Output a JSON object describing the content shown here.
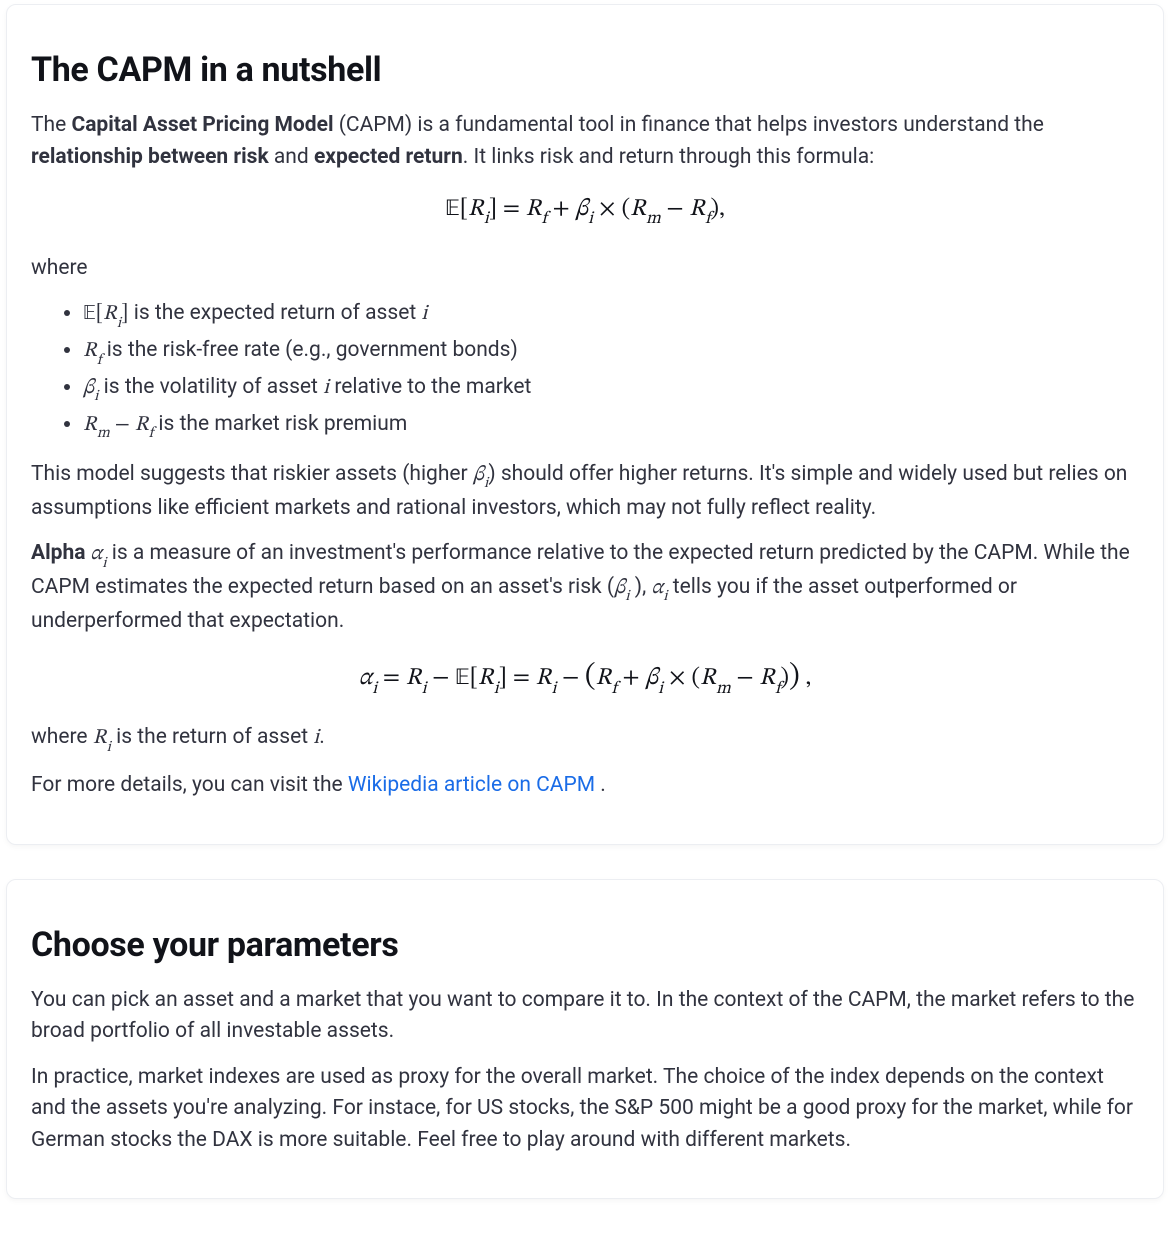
{
  "card1": {
    "heading": "The CAPM in a nutshell",
    "intro_pre": "The ",
    "intro_bold1": "Capital Asset Pricing Model",
    "intro_mid1": " (CAPM) is a fundamental tool in finance that helps investors understand the ",
    "intro_bold2": "relationship between risk",
    "intro_mid2": " and ",
    "intro_bold3": "expected return",
    "intro_post": ". It links risk and return through this formula:",
    "formula1": "𝔼[Rᵢ] = R_f + βᵢ × (Rₘ − R_f),",
    "where_label": "where",
    "defs": {
      "d1_sym": "𝔼[Rᵢ]",
      "d1_txt": " is the expected return of asset ",
      "d1_var": "i",
      "d2_sym": "R_f",
      "d2_txt": " is the risk-free rate (e.g., government bonds)",
      "d3_sym": "βᵢ",
      "d3_txt": " is the volatility of asset ",
      "d3_var": "i",
      "d3_txt2": " relative to the market",
      "d4_sym": "Rₘ − R_f",
      "d4_txt": " is the market risk premium"
    },
    "para2_a": "This model suggests that riskier assets (higher ",
    "para2_beta": "βᵢ",
    "para2_b": ") should offer higher returns. It's simple and widely used but relies on assumptions like efficient markets and rational investors, which may not fully reflect reality.",
    "para3_bold": "Alpha",
    "para3_alpha": " αᵢ",
    "para3_a": " is a measure of an investment's performance relative to the expected return predicted by the CAPM. While the CAPM estimates the expected return based on an asset's risk (",
    "para3_beta2": "βᵢ",
    "para3_b": " ), ",
    "para3_alpha2": "αᵢ",
    "para3_c": " tells you if the asset outperformed or underperformed that expectation.",
    "formula2": "αᵢ = Rᵢ − 𝔼[Rᵢ] = Rᵢ − (R_f + βᵢ × (Rₘ − R_f)) ,",
    "where2_a": "where ",
    "where2_sym": "Rᵢ",
    "where2_b": " is the return of asset ",
    "where2_var": "i",
    "where2_c": ".",
    "link_pre": "For more details, you can visit the ",
    "link_text": "Wikipedia article on CAPM",
    "link_post": " ."
  },
  "card2": {
    "heading": "Choose your parameters",
    "para1": "You can pick an asset and a market that you want to compare it to. In the context of the CAPM, the market refers to the broad portfolio of all investable assets.",
    "para2": "In practice, market indexes are used as proxy for the overall market. The choice of the index depends on the context and the assets you're analyzing. For instace, for US stocks, the S&P 500 might be a good proxy for the market, while for German stocks the DAX is more suitable. Feel free to play around with different markets."
  }
}
